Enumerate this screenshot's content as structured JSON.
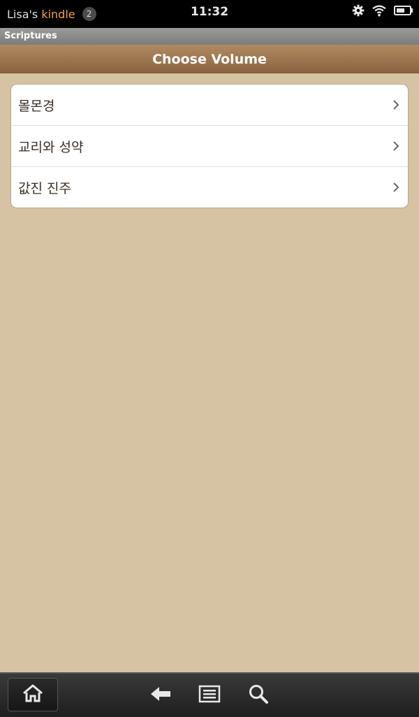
{
  "status": {
    "device_owner": "Lisa's",
    "device_brand": "kindle",
    "notification_count": "2",
    "time": "11:32"
  },
  "app": {
    "title": "Scriptures"
  },
  "nav": {
    "title": "Choose Volume"
  },
  "volumes": [
    {
      "label": "몰몬경"
    },
    {
      "label": "교리와 성약"
    },
    {
      "label": "값진 진주"
    }
  ],
  "icons": {
    "gear": "gear-icon",
    "wifi": "wifi-icon",
    "battery": "battery-icon",
    "chevron": "chevron-right-icon",
    "home": "home-icon",
    "back": "back-arrow-icon",
    "menu": "menu-icon",
    "search": "search-icon"
  },
  "colors": {
    "background": "#d6c3a4",
    "nav_gradient_top": "#b08a61",
    "nav_gradient_bottom": "#8a6440",
    "brand_accent": "#f0a24a"
  }
}
